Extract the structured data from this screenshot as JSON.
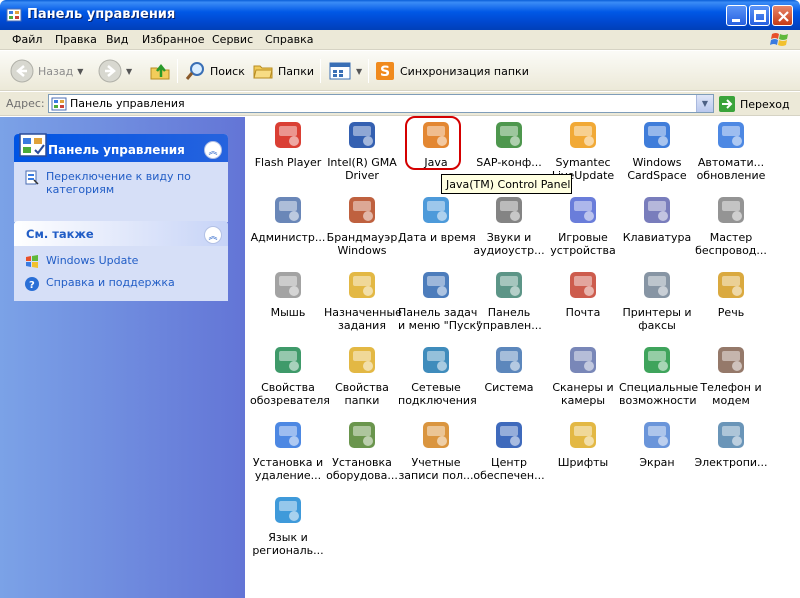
{
  "window": {
    "title": "Панель управления",
    "icon": "control-panel-icon"
  },
  "menu": [
    "Файл",
    "Правка",
    "Вид",
    "Избранное",
    "Сервис",
    "Справка"
  ],
  "toolbar": {
    "back_label": "Назад",
    "search_label": "Поиск",
    "folders_label": "Папки",
    "sync_label": "Синхронизация папки"
  },
  "address": {
    "label": "Адрес:",
    "value": "Панель управления",
    "go_label": "Переход"
  },
  "sidebar": {
    "panel_title": "Панель управления",
    "switch_view_label": "Переключение к виду по категориям",
    "see_also_title": "См. также",
    "see_also": [
      "Windows Update",
      "Справка и поддержка"
    ]
  },
  "items": [
    [
      "Flash Player",
      ""
    ],
    [
      "Intel(R) GMA",
      "Driver"
    ],
    [
      "Java",
      ""
    ],
    [
      "SAP-конф...",
      ""
    ],
    [
      "Symantec",
      "LiveUpdate"
    ],
    [
      "Windows",
      "CardSpace"
    ],
    [
      "Автомати...",
      "обновление"
    ],
    [
      "Администр...",
      ""
    ],
    [
      "Брандмауэр",
      "Windows"
    ],
    [
      "Дата и время",
      ""
    ],
    [
      "Звуки и",
      "аудиоустр..."
    ],
    [
      "Игровые",
      "устройства"
    ],
    [
      "Клавиатура",
      ""
    ],
    [
      "Мастер",
      "беспровод..."
    ],
    [
      "Мышь",
      ""
    ],
    [
      "Назначенные",
      "задания"
    ],
    [
      "Панель задач",
      "и меню \"Пуск\""
    ],
    [
      "Панель",
      "управлен..."
    ],
    [
      "Почта",
      ""
    ],
    [
      "Принтеры и",
      "факсы"
    ],
    [
      "Речь",
      ""
    ],
    [
      "Свойства",
      "обозревателя"
    ],
    [
      "Свойства",
      "папки"
    ],
    [
      "Сетевые",
      "подключения"
    ],
    [
      "Система",
      ""
    ],
    [
      "Сканеры и",
      "камеры"
    ],
    [
      "Специальные",
      "возможности"
    ],
    [
      "Телефон и",
      "модем"
    ],
    [
      "Установка и",
      "удаление..."
    ],
    [
      "Установка",
      "оборудова..."
    ],
    [
      "Учетные",
      "записи пол..."
    ],
    [
      "Центр",
      "обеспечен..."
    ],
    [
      "Шрифты",
      ""
    ],
    [
      "Экран",
      ""
    ],
    [
      "Электропи...",
      ""
    ],
    [
      "Язык и",
      "региональ..."
    ]
  ],
  "item_icons": [
    "flash-icon",
    "intel-gma-icon",
    "java-icon",
    "sap-config-icon",
    "symantec-liveupdate-icon",
    "cardspace-icon",
    "automatic-updates-icon",
    "admin-tools-icon",
    "firewall-icon",
    "date-time-icon",
    "sounds-icon",
    "game-controllers-icon",
    "keyboard-icon",
    "wireless-wizard-icon",
    "mouse-icon",
    "scheduled-tasks-icon",
    "taskbar-icon",
    "nvidia-panel-icon",
    "mail-icon",
    "printers-icon",
    "speech-icon",
    "internet-options-icon",
    "folder-options-icon",
    "network-connections-icon",
    "system-icon",
    "scanners-icon",
    "accessibility-icon",
    "phone-modem-icon",
    "add-remove-programs-icon",
    "add-hardware-icon",
    "user-accounts-icon",
    "security-center-icon",
    "fonts-icon",
    "display-icon",
    "power-options-icon",
    "regional-options-icon"
  ],
  "tooltip": "Java(TM) Control Panel",
  "colors": {
    "titlebar": "#0058e6",
    "sidebar_gradient_start": "#7ba2e7",
    "sidebar_gradient_end": "#6375d6",
    "link": "#215dc6",
    "highlight_ring": "#d40000"
  }
}
